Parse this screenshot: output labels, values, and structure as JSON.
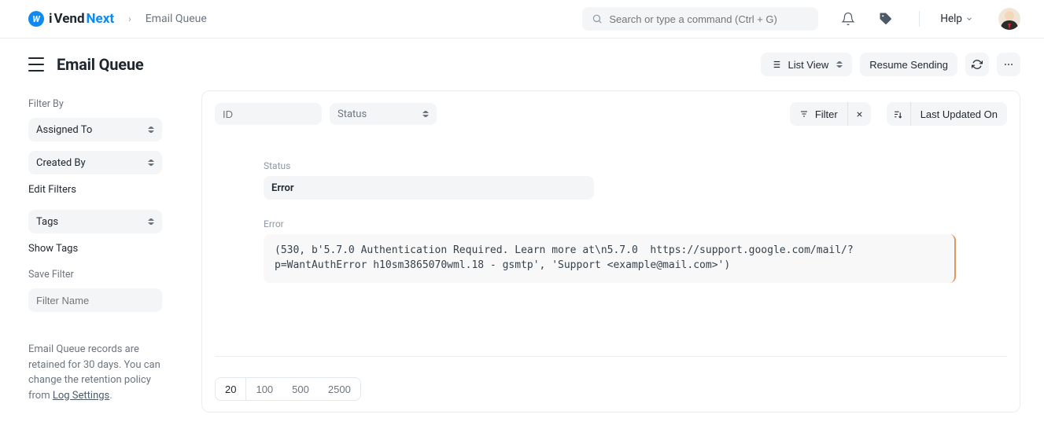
{
  "nav": {
    "brand_i": "i",
    "brand_vend": "Vend",
    "brand_next": "Next",
    "breadcrumb": "Email Queue",
    "search_placeholder": "Search or type a command (Ctrl + G)",
    "help_label": "Help"
  },
  "header": {
    "title": "Email Queue",
    "view_label": "List View",
    "resume_label": "Resume Sending"
  },
  "sidebar": {
    "filter_by_label": "Filter By",
    "assigned_to": "Assigned To",
    "created_by": "Created By",
    "edit_filters": "Edit Filters",
    "tags": "Tags",
    "show_tags": "Show Tags",
    "save_filter_label": "Save Filter",
    "filter_name_placeholder": "Filter Name",
    "retain_pre": "Email Queue records are retained for 30 days. You can change the retention policy from ",
    "retain_link": "Log Settings",
    "retain_post": "."
  },
  "list": {
    "id_placeholder": "ID",
    "status_placeholder": "Status",
    "filter_button": "Filter",
    "sort_label": "Last Updated On"
  },
  "detail": {
    "status_label": "Status",
    "status_value": "Error",
    "error_label": "Error",
    "error_text": "(530, b'5.7.0 Authentication Required. Learn more at\\n5.7.0  https://support.google.com/mail/?p=WantAuthError h10sm3865070wml.18 - gsmtp', 'Support <example@mail.com>')"
  },
  "pager": [
    "20",
    "100",
    "500",
    "2500"
  ],
  "pager_active": "20"
}
